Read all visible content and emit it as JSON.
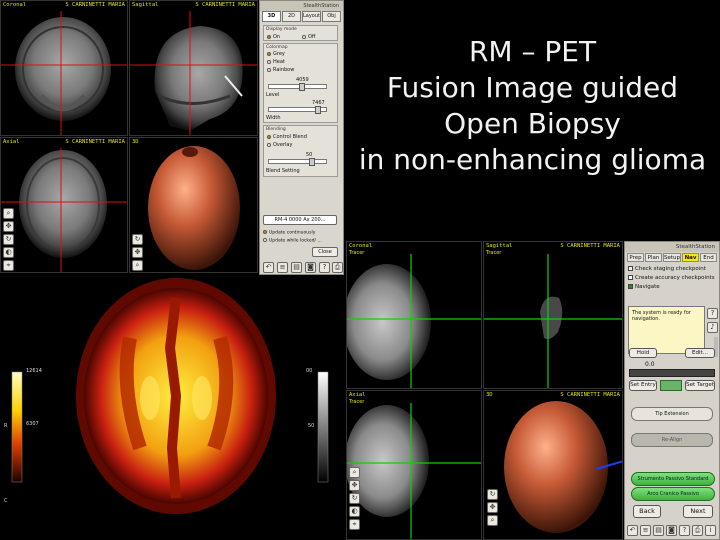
{
  "title": {
    "line1": "RM – PET",
    "line2": "Fusion Image guided",
    "line3": "Open Biopsy",
    "line4": "in non-enhancing glioma"
  },
  "top_viewports": {
    "coronal": {
      "label": "Coronal",
      "patient": "S CARNINETTI MARIA"
    },
    "sagittal": {
      "label": "Sagittal",
      "patient": "S CARNINETTI MARIA"
    },
    "axial": {
      "label": "Axial",
      "patient": "S CARNINETTI MARIA"
    },
    "view3d": {
      "label": "3D"
    }
  },
  "top_panel": {
    "brand": "StealthStation",
    "tabs": [
      "3D",
      "2D",
      "Layout",
      "Obj"
    ],
    "active_tab": "3D",
    "display_title": "Display mode",
    "display_on": "On",
    "display_off": "Off",
    "colormap_title": "Colormap",
    "colormap_options": [
      "Grey",
      "Heat",
      "Rainbow"
    ],
    "selected_colormap": "Grey",
    "level_value": "4059",
    "level_label": "Level",
    "width_value": "7467",
    "width_label": "Width",
    "blending_title": "Blending",
    "blend_options": [
      "Control Blend",
      "Overlay"
    ],
    "blend_value": "50",
    "blend_setting": "Blend Setting",
    "data_button": "RM-4 0000 Ax 200...",
    "close_button": "Close",
    "update_continuous": "Update continuously",
    "update_while": "Update while locked/ ..."
  },
  "pet": {
    "scale_left_top": "12614",
    "scale_left_mid": "6307",
    "scale_right_top": "00",
    "scale_right_mid": "50",
    "side_r": "R",
    "side_c": "C"
  },
  "bottom_viewports": {
    "coronal": {
      "label": "Coronal",
      "sub": "Tracer",
      "patient": "S CARNINETTI MARIA"
    },
    "sagittal": {
      "label": "Sagittal",
      "sub": "Tracer",
      "patient": "S CARNINETTI MARIA"
    },
    "axial": {
      "label": "Axial",
      "sub": "Tracer",
      "patient": "S CARNINETTI MARIA"
    },
    "view3d": {
      "label": "3D",
      "patient": "S CARNINETTI MARIA"
    }
  },
  "nav_panel": {
    "brand": "StealthStation",
    "tabs": [
      "Prep",
      "Plan",
      "Setup",
      "Nav",
      "End"
    ],
    "active_tab": "Nav",
    "check1": "Check staging checkpoint",
    "check2": "Create accuracy checkpoints",
    "check3": "Navigate",
    "message": "The system is ready for navigation.",
    "hold_button": "Hold",
    "edit_button": "Edit...",
    "depth_value": "0.0",
    "set_entry": "Set Entry",
    "set_target": "Set Target",
    "tip_extension": "Tip Extension",
    "re_align": "Re-Align",
    "green1": "Strumento Passivo Standard",
    "green2": "Arco Cranico Passivo",
    "back_button": "Back",
    "next_button": "Next"
  },
  "colors": {
    "title_text": "#f2f2f2",
    "crosshair_red": "#d11",
    "crosshair_green": "#1c1",
    "header_yellow": "#e6e600",
    "nav_active": "#ffe600",
    "green_button": "#55c855"
  }
}
